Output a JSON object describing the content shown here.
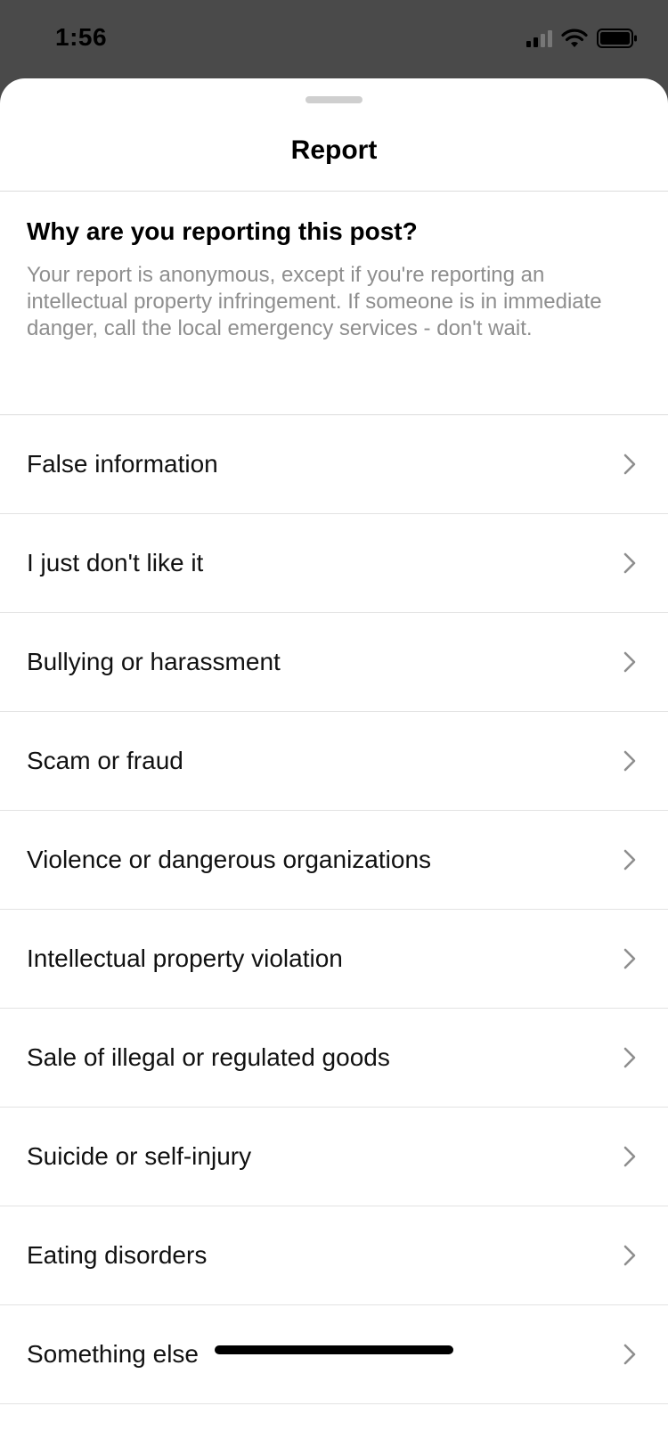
{
  "status_bar": {
    "time": "1:56",
    "signal_icon": "signal-icon",
    "wifi_icon": "wifi-icon",
    "battery_icon": "battery-icon"
  },
  "sheet": {
    "title": "Report",
    "question": "Why are you reporting this post?",
    "description": "Your report is anonymous, except if you're reporting an intellectual property infringement. If someone is in immediate danger, call the local emergency services - don't wait.",
    "options": [
      {
        "label": "False information",
        "icon": "chevron-right-icon"
      },
      {
        "label": "I just don't like it",
        "icon": "chevron-right-icon"
      },
      {
        "label": "Bullying or harassment",
        "icon": "chevron-right-icon"
      },
      {
        "label": "Scam or fraud",
        "icon": "chevron-right-icon"
      },
      {
        "label": "Violence or dangerous organizations",
        "icon": "chevron-right-icon"
      },
      {
        "label": "Intellectual property violation",
        "icon": "chevron-right-icon"
      },
      {
        "label": "Sale of illegal or regulated goods",
        "icon": "chevron-right-icon"
      },
      {
        "label": "Suicide or self-injury",
        "icon": "chevron-right-icon"
      },
      {
        "label": "Eating disorders",
        "icon": "chevron-right-icon"
      },
      {
        "label": "Something else",
        "icon": "chevron-right-icon"
      }
    ]
  },
  "colors": {
    "backdrop": "#4a4a4a",
    "sheet_background": "#ffffff",
    "secondary_text": "#8e8e8e",
    "divider": "#dcdcdc"
  }
}
